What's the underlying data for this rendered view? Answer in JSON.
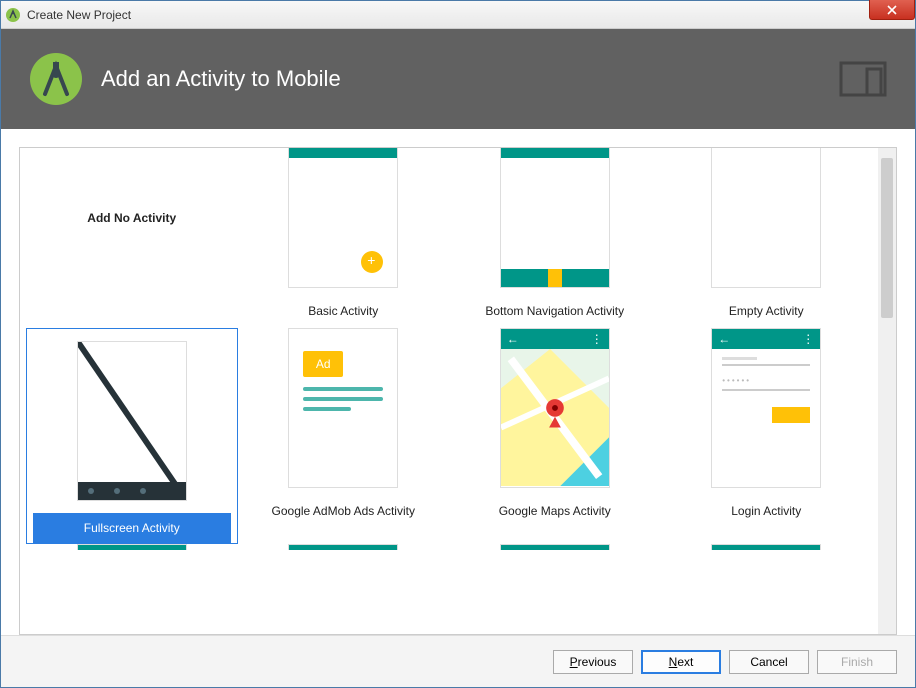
{
  "window": {
    "title": "Create New Project"
  },
  "header": {
    "heading": "Add an Activity to Mobile"
  },
  "templates": {
    "row1": [
      {
        "id": "no-activity",
        "label": "Add No Activity"
      },
      {
        "id": "basic",
        "label": "Basic Activity"
      },
      {
        "id": "bottom-nav",
        "label": "Bottom Navigation Activity"
      },
      {
        "id": "empty",
        "label": "Empty Activity"
      }
    ],
    "row2": [
      {
        "id": "fullscreen",
        "label": "Fullscreen Activity",
        "selected": true
      },
      {
        "id": "admob",
        "label": "Google AdMob Ads Activity",
        "ad_text": "Ad"
      },
      {
        "id": "maps",
        "label": "Google Maps Activity"
      },
      {
        "id": "login",
        "label": "Login Activity"
      }
    ]
  },
  "buttons": {
    "previous": "Previous",
    "next": "Next",
    "cancel": "Cancel",
    "finish": "Finish"
  }
}
